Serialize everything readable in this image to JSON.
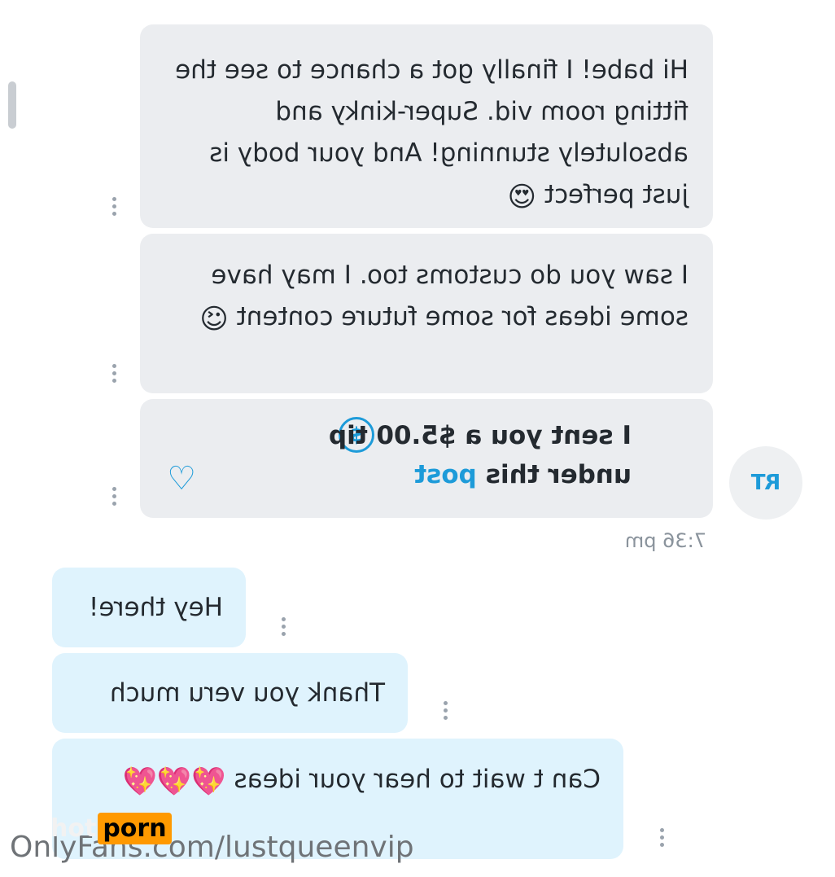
{
  "incoming_messages": [
    {
      "text": "Hi babe! I finally got a chance to see the fitting room vid. Super-kinky and absolutely stunning! And your body is just perfect",
      "emoji": "😍"
    },
    {
      "text": "I saw you do customs too. I may have some ideas for some future content",
      "emoji": "😉"
    }
  ],
  "tip_message": {
    "text": "I sent you a $5.00 tip under this",
    "link": "post",
    "icon": "dollar-circle-icon",
    "heart_icon": "heart-icon"
  },
  "avatar": {
    "initials": "RT"
  },
  "timestamp": "7:36 pm",
  "outgoing_messages": [
    {
      "text": "Hey there!"
    },
    {
      "text": "Thank you veru much"
    },
    {
      "text": "Can t wait to hear your ideas",
      "emoji": "💖💖💖"
    }
  ],
  "watermark": {
    "text": "OnlyFans.com/lustqueenvip",
    "logo_hot": "hot",
    "logo_porn": "porn"
  },
  "colors": {
    "accent": "#1d9bd9",
    "incoming_bg": "#ebedf0",
    "outgoing_bg": "#dff3fd"
  }
}
